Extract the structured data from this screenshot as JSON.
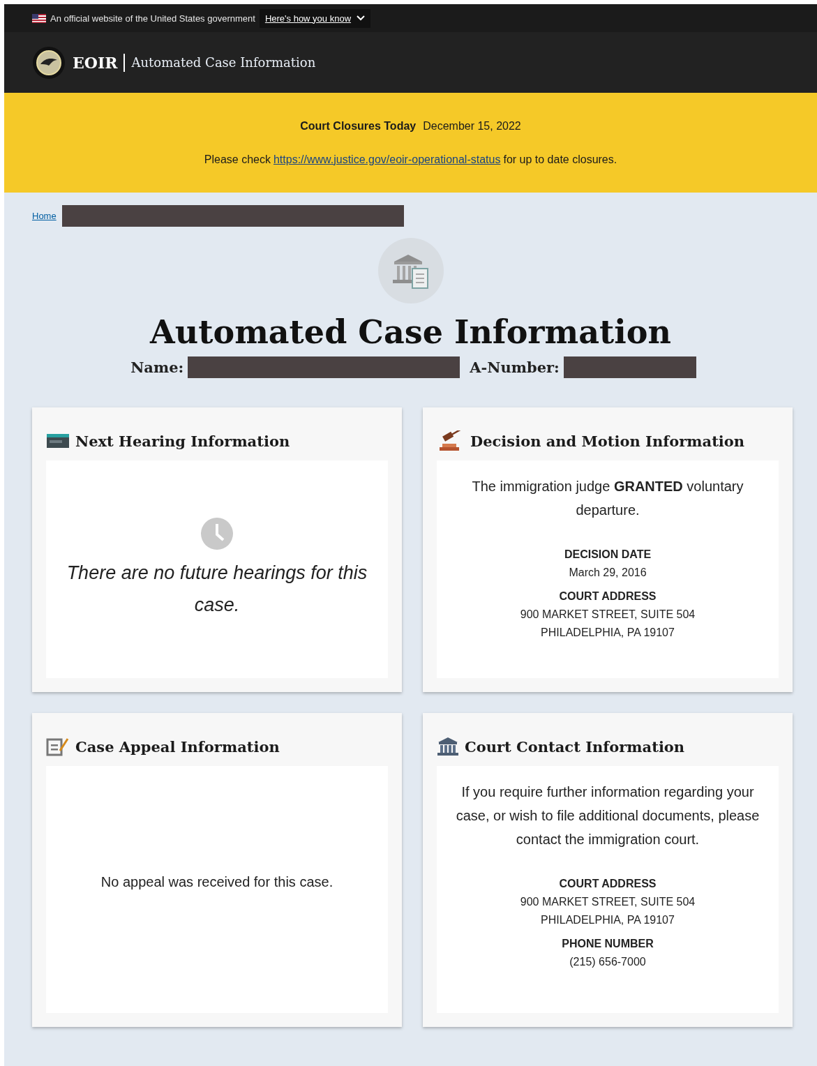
{
  "gov_banner": {
    "text": "An official website of the United States government",
    "link": "Here's how you know"
  },
  "header": {
    "agency": "EOIR",
    "title": "Automated Case Information"
  },
  "alert": {
    "title": "Court Closures Today",
    "date": "December 15, 2022",
    "text_before": "Please check",
    "link": "https://www.justice.gov/eoir-operational-status",
    "text_after": "for up to date closures."
  },
  "breadcrumb": {
    "home": "Home"
  },
  "page_title": "Automated Case Information",
  "case_labels": {
    "name": "Name:",
    "a_number": "A-Number:"
  },
  "cards": [
    {
      "kind": "hearing",
      "title": "Next Hearing Information",
      "message": "There are no future hearings for this case."
    },
    {
      "kind": "decision",
      "title": "Decision and Motion Information",
      "message": "The immigration judge **GRANTED** voluntary departure.",
      "fields": [
        {
          "label": "DECISION DATE",
          "lines": [
            "March 29, 2016"
          ]
        },
        {
          "label": "COURT ADDRESS",
          "lines": [
            "900 MARKET STREET, SUITE 504",
            "PHILADELPHIA, PA 19107"
          ]
        }
      ]
    },
    {
      "kind": "appeal",
      "title": "Case Appeal Information",
      "message": "No appeal was received for this case."
    },
    {
      "kind": "contact",
      "title": "Court Contact Information",
      "message": "If you require further information regarding your case, or wish to file additional documents, please contact the immigration court.",
      "fields": [
        {
          "label": "COURT ADDRESS",
          "lines": [
            "900 MARKET STREET, SUITE 504",
            "PHILADELPHIA, PA 19107"
          ]
        },
        {
          "label": "PHONE NUMBER",
          "lines": [
            "(215) 656-7000"
          ]
        }
      ]
    }
  ]
}
